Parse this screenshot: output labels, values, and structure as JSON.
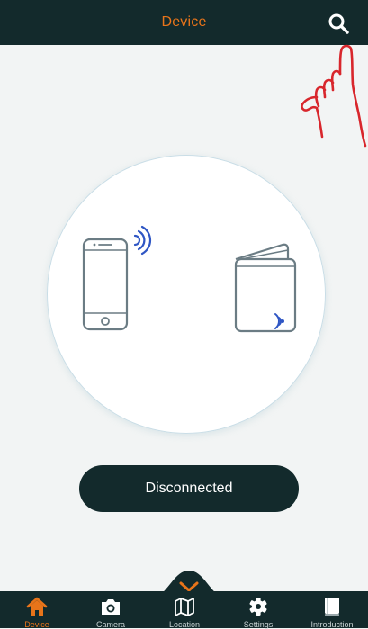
{
  "header": {
    "title": "Device",
    "search_icon": "search-icon"
  },
  "main": {
    "status_label": "Disconnected",
    "illustration": {
      "phone_icon": "smartphone-icon",
      "signal_icon": "wireless-signal-icon",
      "wallet_icon": "wallet-icon",
      "annotation_icon": "pointing-hand-annotation"
    }
  },
  "bottom_nav": {
    "collapse_icon": "chevron-down-icon",
    "active_tab": "Device",
    "tabs": [
      {
        "label": "Device",
        "icon": "home-icon"
      },
      {
        "label": "Camera",
        "icon": "camera-icon"
      },
      {
        "label": "Location",
        "icon": "map-icon"
      },
      {
        "label": "Settings",
        "icon": "gear-icon"
      },
      {
        "label": "Introduction",
        "icon": "book-icon"
      }
    ]
  },
  "colors": {
    "header_bg": "#132a2c",
    "accent": "#e8741a",
    "page_bg": "#f2f4f4",
    "signal_blue": "#2f56c4",
    "annotation_red": "#d8262c",
    "icon_stroke": "#6b7c84"
  }
}
